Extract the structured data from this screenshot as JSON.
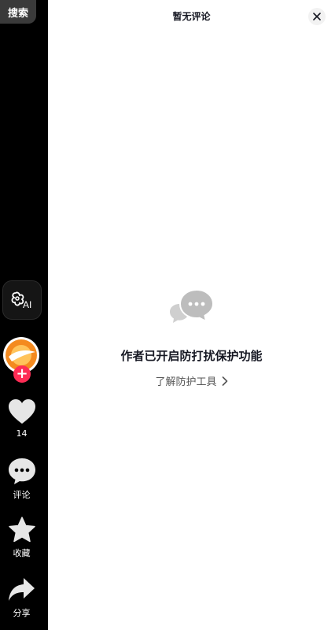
{
  "sidebar": {
    "search_label": "搜索",
    "ai_label": "AI",
    "likes": {
      "icon": "heart-icon",
      "count": "14"
    },
    "comment": {
      "icon": "comment-icon",
      "label": "评论"
    },
    "favorite": {
      "icon": "star-icon",
      "label": "收藏"
    },
    "share": {
      "icon": "share-icon",
      "label": "分享"
    },
    "follow_icon": "plus-icon"
  },
  "panel": {
    "title": "暂无评论",
    "empty_title": "作者已开启防打扰保护功能",
    "learn_link": "了解防护工具",
    "close_icon": "close-icon"
  },
  "colors": {
    "accent": "#fe2c55",
    "panel_bg": "#ffffff",
    "rail_bg": "#000000"
  }
}
